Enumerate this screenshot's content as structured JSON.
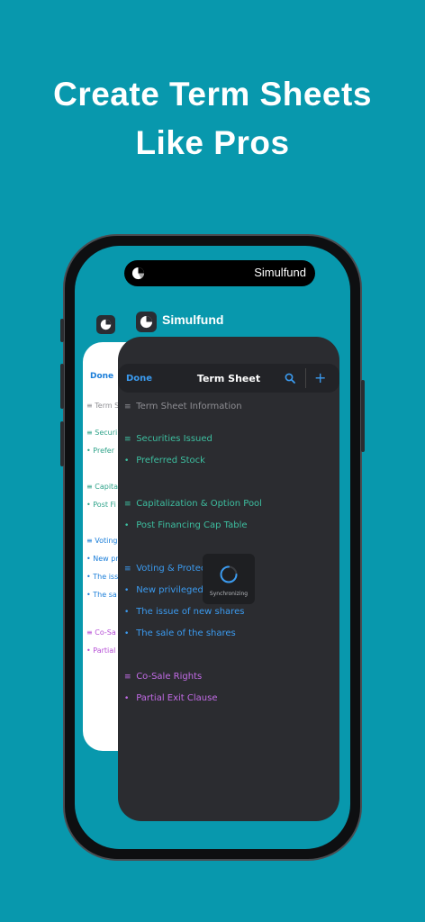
{
  "headline": {
    "line1": "Create Term Sheets",
    "line2": "Like Pros"
  },
  "island": {
    "app_name": "Simulfund",
    "logo_icon": "simulfund-logo-icon"
  },
  "app_switcher": {
    "app_label": "Simulfund"
  },
  "light_card": {
    "done_label": "Done",
    "rows": [
      {
        "glyph": "≡",
        "text": "Term S",
        "color": "#8e8e93"
      },
      {
        "glyph": "≡",
        "text": "Securi",
        "color": "#2fa38a"
      },
      {
        "glyph": "•",
        "text": "Prefer",
        "color": "#2fa38a"
      },
      {
        "glyph": "≡",
        "text": "Capita",
        "color": "#2fa38a"
      },
      {
        "glyph": "•",
        "text": "Post Fi",
        "color": "#2fa38a"
      },
      {
        "glyph": "≡",
        "text": "Voting",
        "color": "#1b7ed9"
      },
      {
        "glyph": "•",
        "text": "New pri",
        "color": "#1b7ed9"
      },
      {
        "glyph": "•",
        "text": "The iss",
        "color": "#1b7ed9"
      },
      {
        "glyph": "•",
        "text": "The sa",
        "color": "#1b7ed9"
      },
      {
        "glyph": "≡",
        "text": "Co-Sa",
        "color": "#b64fd6"
      },
      {
        "glyph": "•",
        "text": "Partial",
        "color": "#b64fd6"
      }
    ]
  },
  "dark_card": {
    "nav": {
      "done_label": "Done",
      "title": "Term Sheet",
      "add_label": "+"
    },
    "rows": [
      {
        "glyph": "≡",
        "text": "Term Sheet Information",
        "color": "#8e8e93"
      },
      {
        "glyph": "≡",
        "text": "Securities Issued",
        "color": "#3dbfa0"
      },
      {
        "glyph": "•",
        "text": "Preferred Stock",
        "color": "#3dbfa0"
      },
      {
        "glyph": "≡",
        "text": "Capitalization & Option Pool",
        "color": "#3dbfa0"
      },
      {
        "glyph": "•",
        "text": "Post Financing Cap Table",
        "color": "#3dbfa0"
      },
      {
        "glyph": "≡",
        "text": "Voting & Protecti",
        "color": "#3b9bf0"
      },
      {
        "glyph": "•",
        "text": "New privileged cl",
        "color": "#3b9bf0"
      },
      {
        "glyph": "•",
        "text": "The issue of new shares",
        "color": "#3b9bf0"
      },
      {
        "glyph": "•",
        "text": "The sale of the shares",
        "color": "#3b9bf0"
      },
      {
        "glyph": "≡",
        "text": "Co-Sale Rights",
        "color": "#c26be6"
      },
      {
        "glyph": "•",
        "text": "Partial Exit Clause",
        "color": "#c26be6"
      }
    ],
    "sync_label": "Synchronizing"
  },
  "colors": {
    "background": "#0898ad",
    "accent_blue": "#3b9bf0",
    "dark_card": "#2b2c30"
  }
}
